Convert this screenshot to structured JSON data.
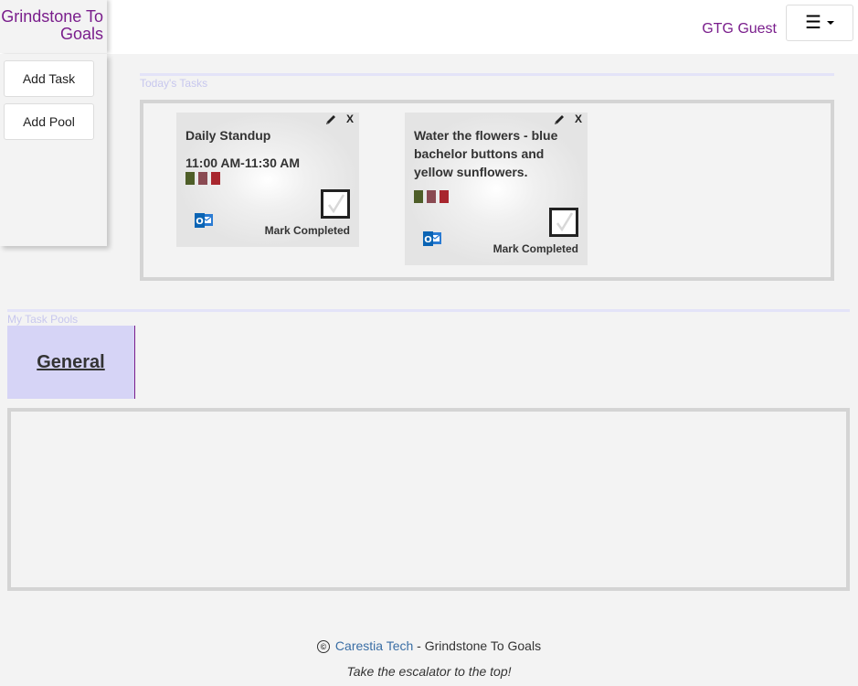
{
  "header": {
    "brand": "Grindstone To Goals",
    "user": "GTG Guest",
    "menu_icon": "hamburger-icon"
  },
  "sidebar": {
    "add_task": "Add Task",
    "add_pool": "Add Pool"
  },
  "today": {
    "label": "Today's Tasks",
    "tasks": [
      {
        "title": "Daily Standup",
        "time": "11:00 AM-11:30 AM",
        "mark_label": "Mark Completed",
        "close": "X"
      },
      {
        "title": "Water the flowers - blue bachelor buttons and yellow sunflowers.",
        "time": "",
        "mark_label": "Mark Completed",
        "close": "X"
      }
    ],
    "swatch_colors": [
      "#4e5e28",
      "#8a4a52",
      "#a8262e"
    ]
  },
  "pools": {
    "label": "My Task Pools",
    "tabs": [
      {
        "name": "General"
      }
    ]
  },
  "footer": {
    "copyright_symbol": "©",
    "company": "Carestia Tech",
    "separator": " - Grindstone To Goals",
    "tagline": "Take the escalator to the top!"
  }
}
